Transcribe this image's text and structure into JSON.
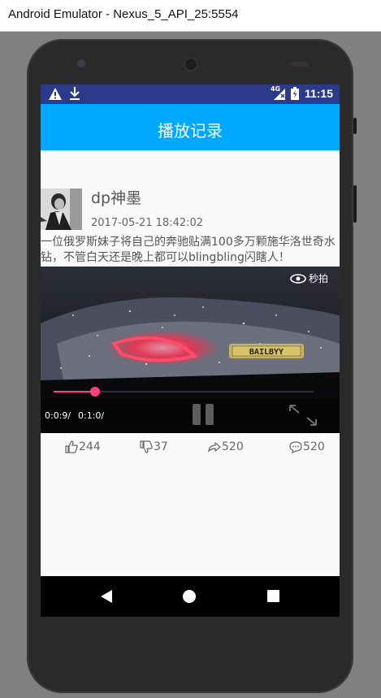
{
  "window": {
    "title": "Android Emulator - Nexus_5_API_25:5554"
  },
  "statusbar": {
    "time": "11:15",
    "network": "4G",
    "icons": [
      "warning-icon",
      "download-icon",
      "signal-icon",
      "battery-icon"
    ]
  },
  "appbar": {
    "title": "播放记录"
  },
  "post": {
    "username": "dp神墨",
    "timestamp": "2017-05-21 18:42:02",
    "content": "一位俄罗斯妹子将自己的奔驰贴满100多万颗施华洛世奇水钻，不管白天还是晚上都可以blingbling闪瞎人！",
    "video": {
      "watermark": "秒拍",
      "plate_text": "BAILBYY",
      "current_time": "0:0:9/",
      "total_time": "0:1:0/",
      "progress": 0.16
    },
    "actions": {
      "likes": "244",
      "dislikes": "37",
      "shares": "520",
      "comments": "520"
    }
  },
  "colors": {
    "appbar": "#00a9ff",
    "statusbar": "#2c3a8c",
    "progress": "#ff3f80"
  }
}
